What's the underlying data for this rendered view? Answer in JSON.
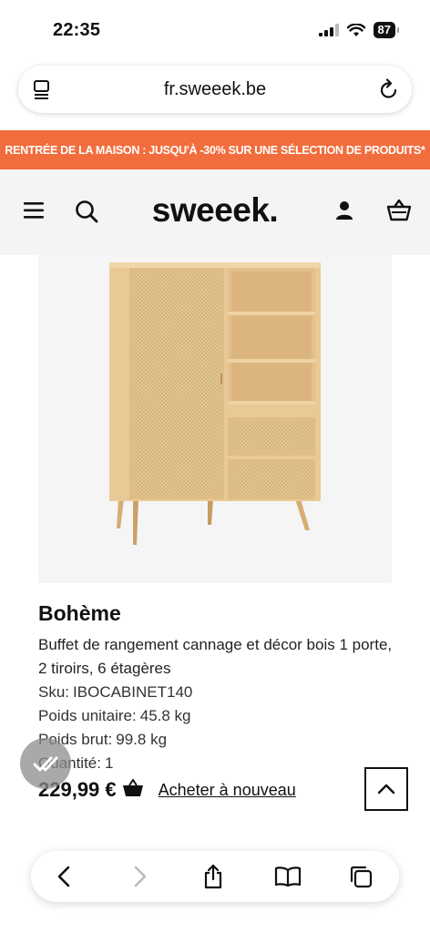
{
  "status": {
    "time": "22:35",
    "battery": "87"
  },
  "browser": {
    "url": "fr.sweeek.be"
  },
  "promo": {
    "text": "RENTRÉE DE LA MAISON : JUSQU'À -30% SUR UNE SÉLECTION DE PRODUITS*"
  },
  "header": {
    "logo": "sweeek."
  },
  "product": {
    "name": "Bohème",
    "description": "Buffet de rangement cannage et décor bois 1 porte, 2 tiroirs, 6 étagères",
    "sku_label": "Sku:",
    "sku": "IBOCABINET140",
    "unit_weight_label": "Poids unitaire:",
    "unit_weight": "45.8 kg",
    "gross_weight_label": "Poids brut:",
    "gross_weight": "99.8 kg",
    "quantity_label": "Quantité:",
    "quantity": "1",
    "price": "229,99 €",
    "buy_again": "Acheter à nouveau"
  },
  "colors": {
    "promo_bg": "#f26d3d",
    "header_bg": "#f4f4f4",
    "wood": "#e8c48e",
    "cane": "#e2c693"
  },
  "icons": [
    "tabs-icon",
    "reload-icon",
    "menu-icon",
    "search-icon",
    "account-icon",
    "cart-icon",
    "basket-icon",
    "chevron-up-icon",
    "check-icon",
    "back-icon",
    "forward-icon",
    "share-icon",
    "bookmarks-icon",
    "tabs-overview-icon"
  ]
}
